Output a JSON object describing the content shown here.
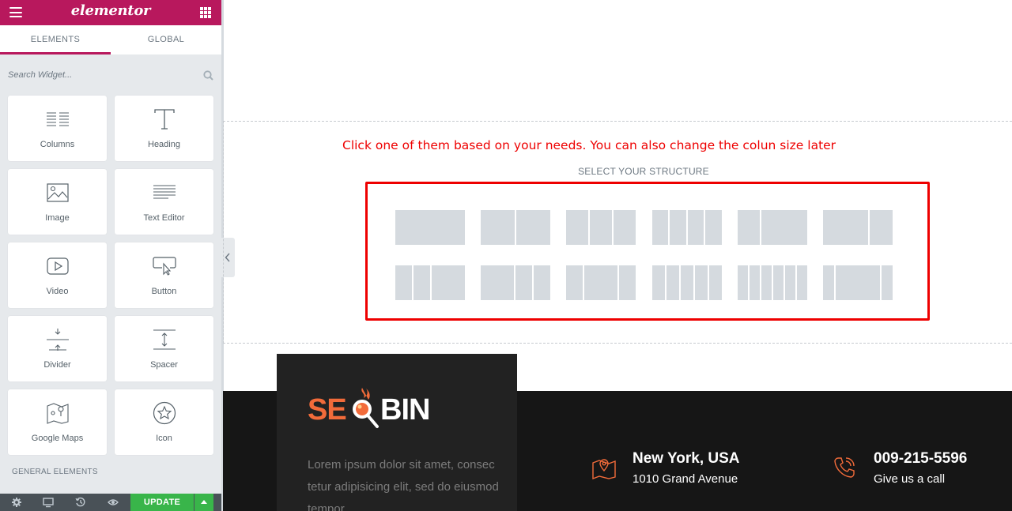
{
  "sidebar": {
    "logo": "elementor",
    "tabs": [
      "ELEMENTS",
      "GLOBAL"
    ],
    "search_placeholder": "Search Widget...",
    "widgets": [
      {
        "label": "Columns",
        "icon": "columns-icon"
      },
      {
        "label": "Heading",
        "icon": "heading-icon"
      },
      {
        "label": "Image",
        "icon": "image-icon"
      },
      {
        "label": "Text Editor",
        "icon": "text-editor-icon"
      },
      {
        "label": "Video",
        "icon": "video-icon"
      },
      {
        "label": "Button",
        "icon": "button-icon"
      },
      {
        "label": "Divider",
        "icon": "divider-icon"
      },
      {
        "label": "Spacer",
        "icon": "spacer-icon"
      },
      {
        "label": "Google Maps",
        "icon": "google-maps-icon"
      },
      {
        "label": "Icon",
        "icon": "star-icon"
      }
    ],
    "section_title": "GENERAL ELEMENTS",
    "footer": {
      "update_label": "UPDATE",
      "icons": [
        "settings-icon",
        "responsive-icon",
        "history-icon",
        "preview-icon"
      ]
    }
  },
  "canvas": {
    "instruction": "Click one of them based on your needs. You can also change the colun size later",
    "structure_title": "SELECT YOUR STRUCTURE",
    "presets": [
      {
        "name": "one-column",
        "cols": [
          100
        ]
      },
      {
        "name": "two-columns",
        "cols": [
          50,
          50
        ]
      },
      {
        "name": "three-columns",
        "cols": [
          33,
          33,
          33
        ]
      },
      {
        "name": "four-columns",
        "cols": [
          25,
          25,
          25,
          25
        ]
      },
      {
        "name": "two-columns-33-66",
        "cols": [
          33,
          66
        ]
      },
      {
        "name": "two-columns-66-33",
        "cols": [
          66,
          33
        ]
      },
      {
        "name": "three-columns-25-25-50",
        "cols": [
          25,
          25,
          50
        ]
      },
      {
        "name": "three-columns-50-25-25",
        "cols": [
          50,
          25,
          25
        ]
      },
      {
        "name": "three-columns-25-50-25",
        "cols": [
          25,
          50,
          25
        ]
      },
      {
        "name": "five-columns",
        "cols": [
          20,
          20,
          20,
          20,
          20
        ]
      },
      {
        "name": "six-columns",
        "cols": [
          16,
          16,
          16,
          16,
          16,
          16
        ]
      },
      {
        "name": "three-columns-16-66-16",
        "cols": [
          16,
          66,
          16
        ]
      }
    ]
  },
  "site_footer": {
    "brand_prefix": "SE",
    "brand_suffix": "BIN",
    "description": "Lorem ipsum dolor sit amet, consec tetur adipisicing elit, sed do eiusmod tempor",
    "contacts": [
      {
        "title": "New York, USA",
        "subtitle": "1010 Grand Avenue",
        "icon": "map-icon"
      },
      {
        "title": "009-215-5596",
        "subtitle": "Give us a call",
        "icon": "phone-icon"
      }
    ],
    "colors": {
      "accent": "#f26b3a",
      "dark": "#161616",
      "panel": "#222222"
    }
  },
  "colors": {
    "brand": "#b8185d",
    "highlight": "#ee0000",
    "update": "#39b54a"
  }
}
